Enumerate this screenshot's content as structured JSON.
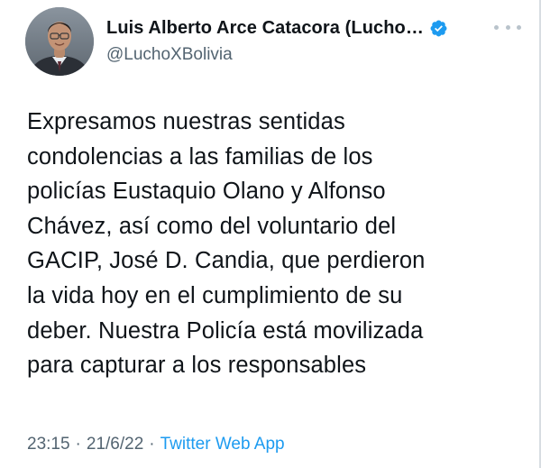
{
  "header": {
    "display_name": "Luis Alberto Arce Catacora (Lucho…",
    "handle": "@LuchoXBolivia",
    "verified_icon": "verified-badge-icon",
    "more_icon": "more-options-icon"
  },
  "tweet": {
    "lines": [
      "Expresamos nuestras sentidas",
      "condolencias a las familias de los",
      "policías Eustaquio Olano y Alfonso",
      "Chávez, así como del voluntario del",
      "GACIP, José D. Candia, que perdieron",
      "la vida hoy en el cumplimiento de su",
      "deber. Nuestra Policía está movilizada",
      "para capturar a los responsables"
    ]
  },
  "meta": {
    "time": "23:15",
    "separator": "·",
    "date": "21/6/22",
    "source": "Twitter Web App"
  },
  "colors": {
    "text": "#0f1419",
    "secondary": "#536471",
    "accent": "#1d9bf0"
  }
}
